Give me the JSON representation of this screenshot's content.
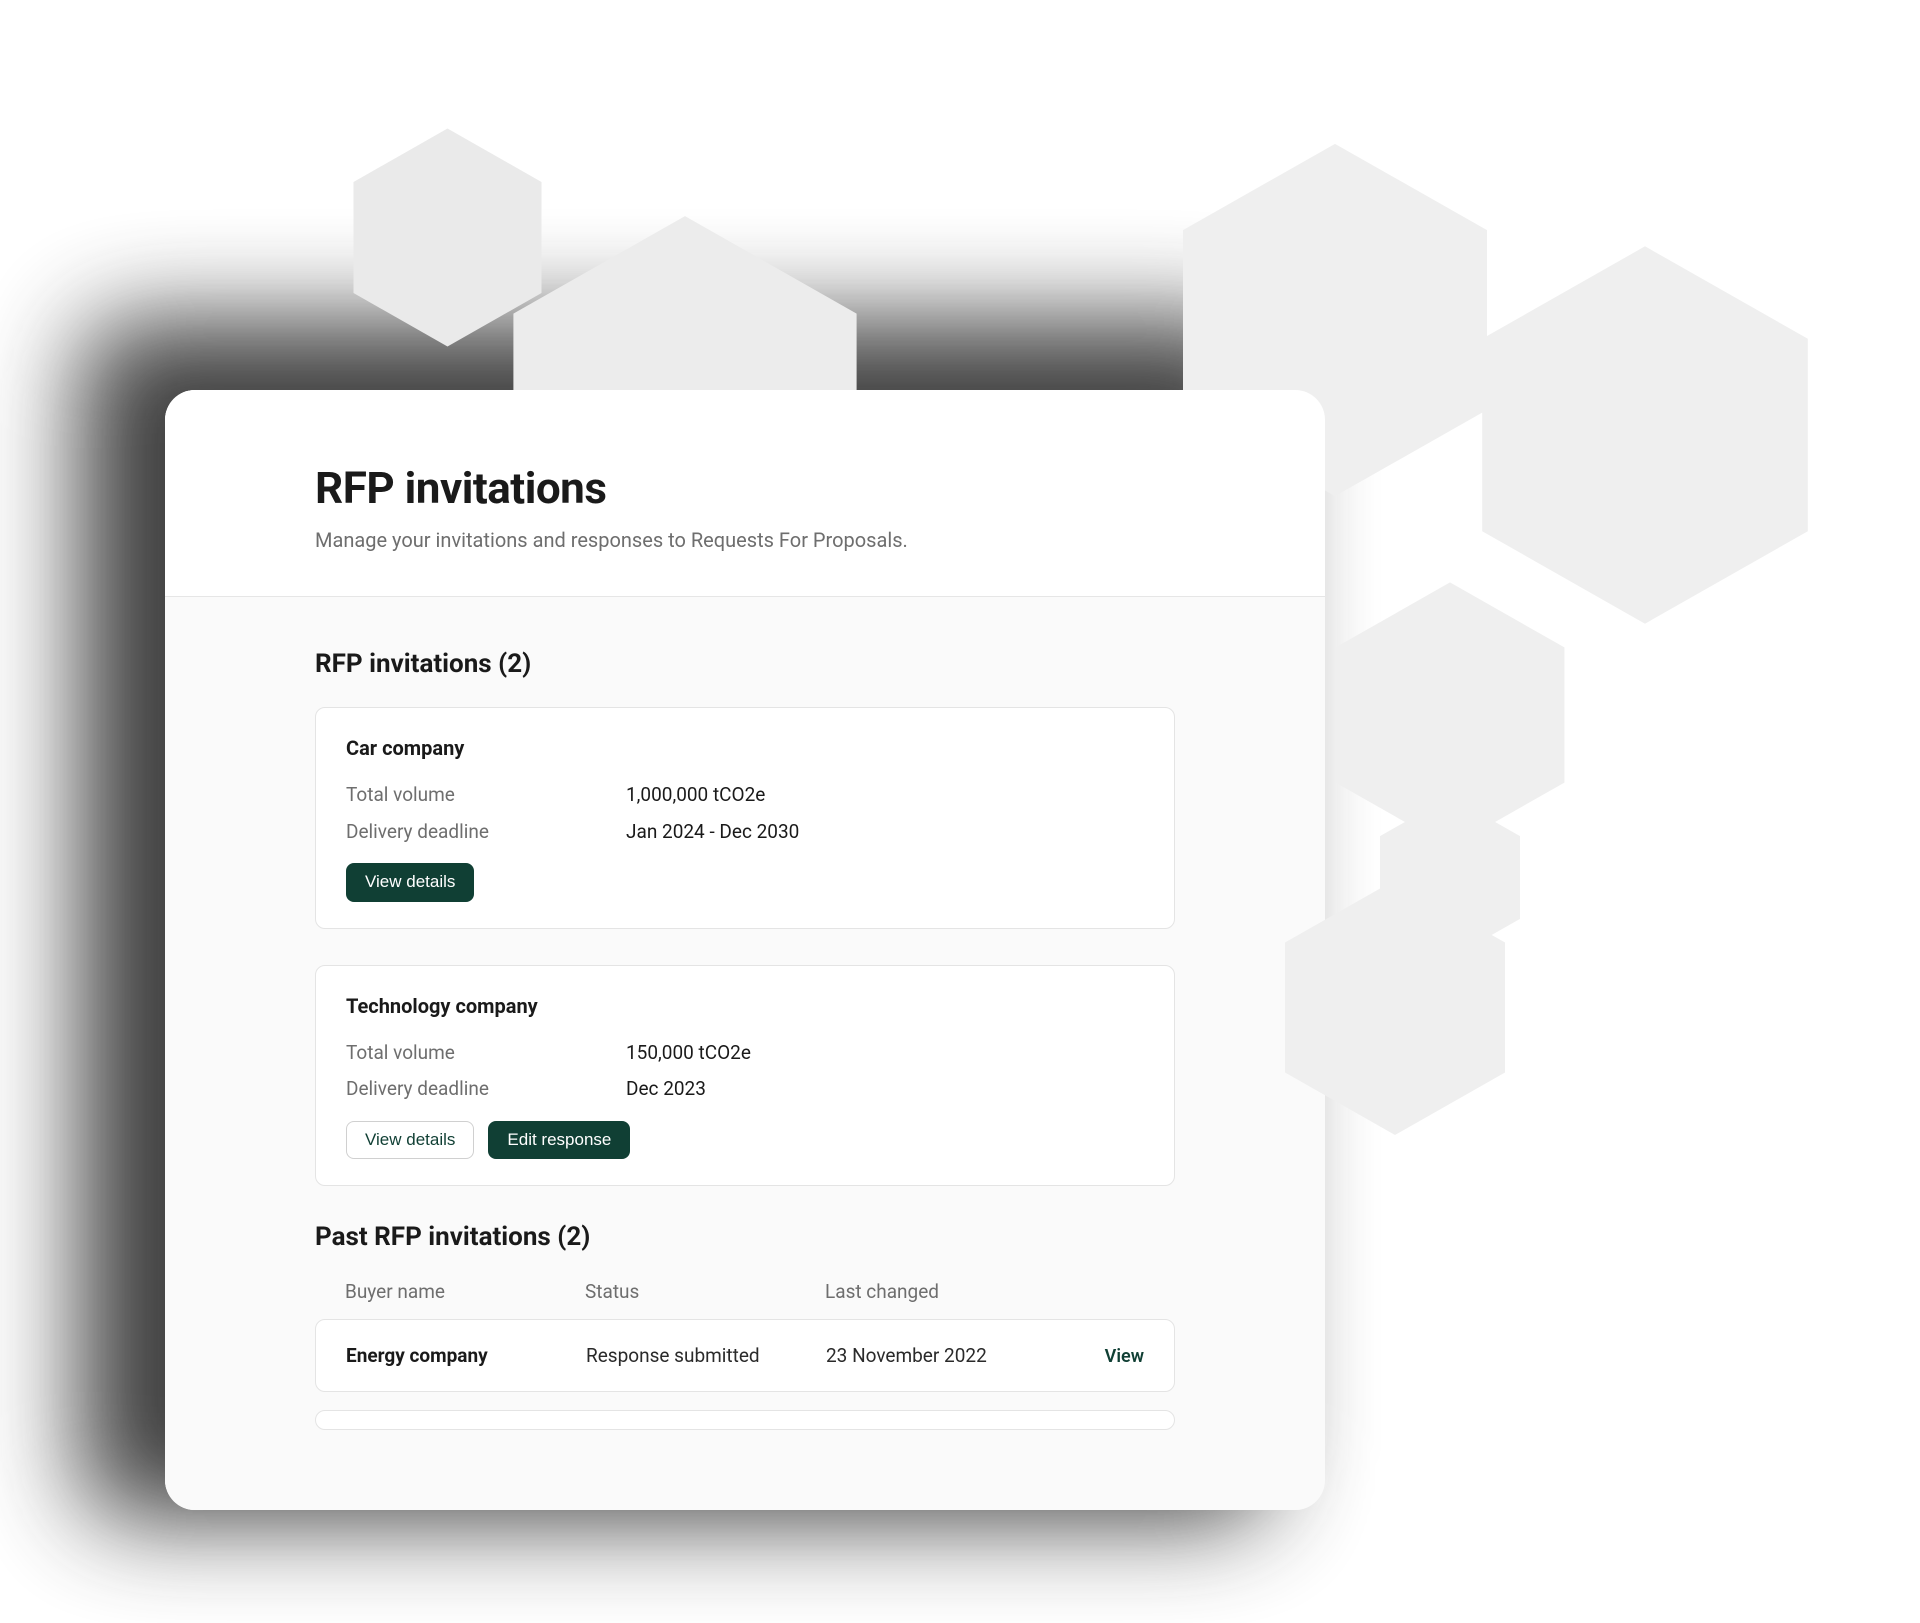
{
  "colors": {
    "accent": "#103f34",
    "text_primary": "#1a1a1a",
    "text_muted": "#6e6e6e",
    "border": "#e4e4e4",
    "panel_bg": "#ffffff",
    "body_bg": "#fafafa"
  },
  "header": {
    "title": "RFP invitations",
    "subtitle": "Manage your invitations and responses to Requests For Proposals."
  },
  "current_section": {
    "title": "RFP invitations (2)",
    "count": 2,
    "labels": {
      "total_volume": "Total volume",
      "delivery_deadline": "Delivery deadline",
      "view_details": "View details",
      "edit_response": "Edit response"
    },
    "items": [
      {
        "name": "Car company",
        "total_volume": "1,000,000 tCO2e",
        "delivery_deadline": "Jan 2024 - Dec 2030",
        "has_edit": false
      },
      {
        "name": "Technology company",
        "total_volume": "150,000 tCO2e",
        "delivery_deadline": "Dec 2023",
        "has_edit": true
      }
    ]
  },
  "past_section": {
    "title": "Past RFP invitations (2)",
    "count": 2,
    "columns": {
      "buyer": "Buyer name",
      "status": "Status",
      "last_changed": "Last changed"
    },
    "view_label": "View",
    "rows": [
      {
        "buyer": "Energy company",
        "status": "Response submitted",
        "last_changed": "23 November 2022"
      }
    ]
  }
}
